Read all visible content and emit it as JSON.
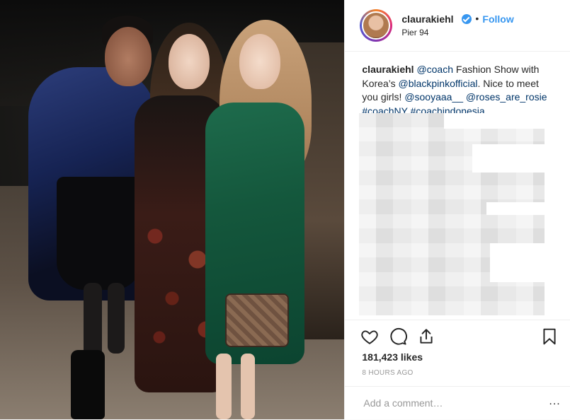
{
  "header": {
    "username": "claurakiehl",
    "separator": "•",
    "follow_label": "Follow",
    "location": "Pier 94"
  },
  "caption": {
    "username": "claurakiehl",
    "mention_coach": "@coach",
    "text_1": " Fashion Show with Korea’s ",
    "mention_blackpink": "@blackpinkofficial",
    "text_2": ". Nice to meet you girls! ",
    "mention_sooyaaa": "@sooyaaa__",
    "text_3": " ",
    "mention_roses": "@roses_are_rosie",
    "text_4": " ",
    "hashtag_coachny": "#coachNY",
    "text_5": " ",
    "hashtag_coachindonesia": "#coachindonesia"
  },
  "stats": {
    "likes": "181,423 likes",
    "time_ago": "8 HOURS AGO"
  },
  "comment": {
    "placeholder": "Add a comment…",
    "more_label": "..."
  },
  "icons": {
    "heart": "heart-icon",
    "comment": "comment-icon",
    "share": "share-icon",
    "bookmark": "bookmark-icon",
    "verified": "verified-badge-icon"
  },
  "colors": {
    "accent": "#3897f0",
    "text": "#262626",
    "muted": "#999999",
    "link": "#003569"
  }
}
